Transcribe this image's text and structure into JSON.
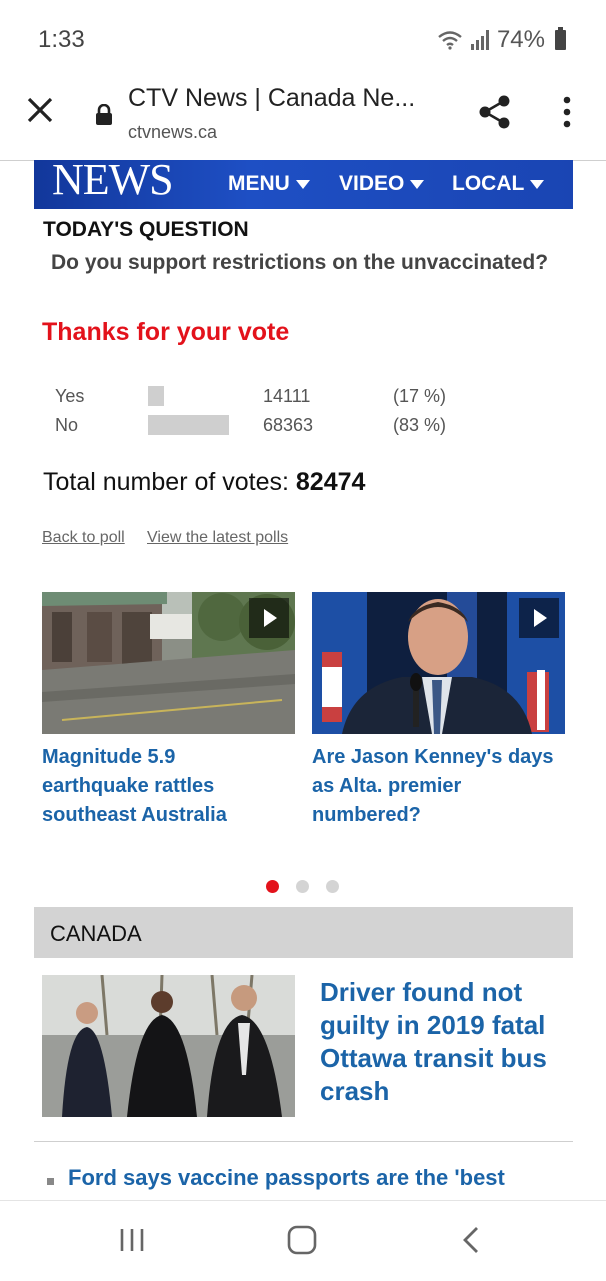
{
  "status_bar": {
    "time": "1:33",
    "battery": "74%"
  },
  "browser": {
    "title": "CTV News | Canada Ne...",
    "url": "ctvnews.ca"
  },
  "site_header": {
    "logo": "NEWS",
    "nav": [
      "MENU",
      "VIDEO",
      "LOCAL"
    ]
  },
  "poll": {
    "label": "TODAY'S QUESTION",
    "question": "Do you support restrictions on the unvaccinated?",
    "thanks": "Thanks for your vote",
    "results": [
      {
        "label": "Yes",
        "count": "14111",
        "pct": "(17 %)",
        "share": 0.17
      },
      {
        "label": "No",
        "count": "68363",
        "pct": "(83 %)",
        "share": 0.83
      }
    ],
    "total_label": "Total number of votes: ",
    "total_value": "82474",
    "back_link": "Back to poll",
    "latest_link": "View the latest polls"
  },
  "carousel": {
    "items": [
      {
        "headline": "Magnitude 5.9 earthquake rattles southeast Australia"
      },
      {
        "headline": "Are Jason Kenney's days as Alta. premier numbered?"
      }
    ],
    "active_index": 0
  },
  "canada": {
    "section_label": "CANADA",
    "lead_headline": "Driver found not guilty in 2019 fatal Ottawa transit bus crash",
    "next_item": "Ford says vaccine passports are the 'best"
  },
  "icons": {
    "close": "close-icon",
    "lock": "lock-icon",
    "share": "share-icon",
    "more": "more-vert-icon",
    "play": "play-icon",
    "wifi": "wifi-icon",
    "signal": "signal-icon",
    "battery": "battery-icon",
    "recents": "recents-icon",
    "home": "home-icon",
    "back": "back-icon"
  },
  "colors": {
    "ctv_blue": "#1e4fc4",
    "accent_red": "#e3121b",
    "headline_blue": "#1b64a8"
  }
}
